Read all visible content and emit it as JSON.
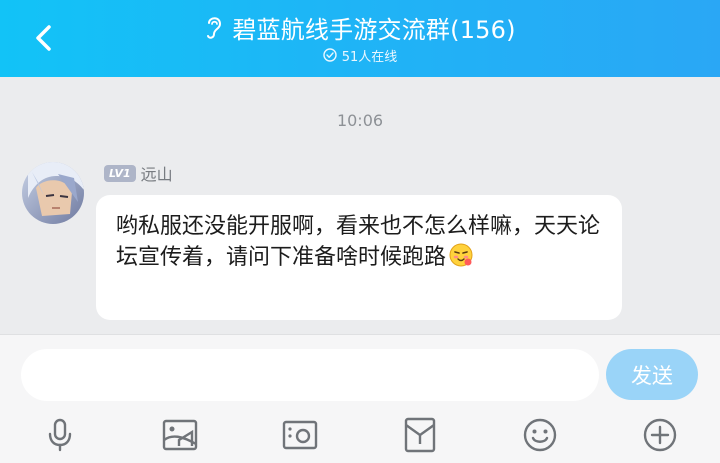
{
  "header": {
    "back_icon": "chevron-left-icon",
    "mode_icon": "ear-icon",
    "title": "碧蓝航线手游交流群(156)",
    "online_icon": "check-circle-icon",
    "online_text": "51人在线"
  },
  "chat": {
    "timestamp": "10:06",
    "messages": [
      {
        "level_badge": "LV1",
        "sender": "远山",
        "avatar_icon": "user-avatar",
        "text": "哟私服还没能开服啊，看来也不怎么样嘛，天天论坛宣传着，请问下准备啥时候跑路",
        "emoji_icon": "sly-face-emoji-icon"
      }
    ]
  },
  "composer": {
    "input_value": "",
    "input_placeholder": "",
    "send_label": "发送"
  },
  "toolbar": {
    "items": [
      {
        "icon": "microphone-icon"
      },
      {
        "icon": "image-icon"
      },
      {
        "icon": "camera-icon"
      },
      {
        "icon": "red-packet-icon"
      },
      {
        "icon": "smiley-icon"
      },
      {
        "icon": "plus-circle-icon"
      }
    ]
  },
  "colors": {
    "header_start": "#12c3f7",
    "header_end": "#2aa7f5",
    "send_button": "#9ad4f8",
    "chat_background": "#ebecee"
  }
}
